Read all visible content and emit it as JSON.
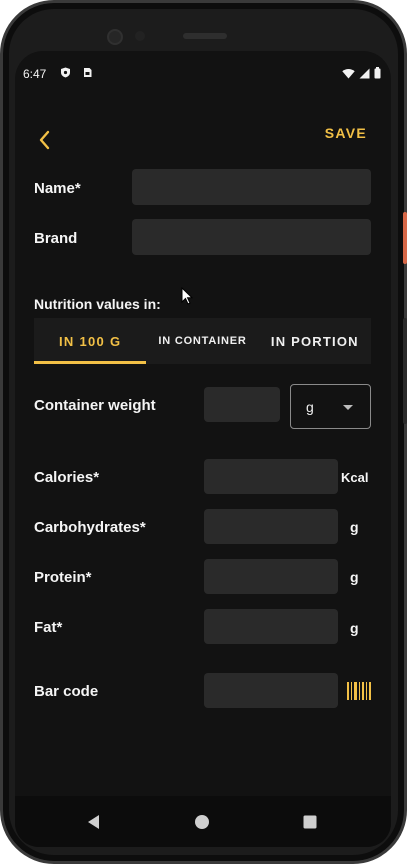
{
  "status_bar": {
    "time": "6:47",
    "left_icons": [
      "shield-icon",
      "sim-icon"
    ],
    "right_icons": [
      "wifi-icon",
      "signal-icon",
      "battery-icon"
    ]
  },
  "app_bar": {
    "back_icon": "chevron-left-icon",
    "save_label": "SAVE"
  },
  "form": {
    "name": {
      "label": "Name*",
      "value": ""
    },
    "brand": {
      "label": "Brand",
      "value": ""
    },
    "nutrition_values_label": "Nutrition values in:",
    "tabs": [
      {
        "label": "IN 100 G",
        "selected": true
      },
      {
        "label": "IN CONTAINER",
        "selected": false
      },
      {
        "label": "IN PORTION",
        "selected": false
      }
    ],
    "container_weight": {
      "label": "Container weight",
      "value": "",
      "unit_selected": "g"
    },
    "calories": {
      "label": "Calories*",
      "value": "",
      "unit": "Kcal"
    },
    "carbohydrates": {
      "label": "Carbohydrates*",
      "value": "",
      "unit": "g"
    },
    "protein": {
      "label": "Protein*",
      "value": "",
      "unit": "g"
    },
    "fat": {
      "label": "Fat*",
      "value": "",
      "unit": "g"
    },
    "bar_code": {
      "label": "Bar code",
      "value": "",
      "icon": "barcode-icon"
    }
  },
  "colors": {
    "accent": "#f2c046",
    "background": "#121212",
    "field": "#2a2a2a",
    "tab_bar": "#1b1b1b"
  },
  "nav_bar": {
    "icons": [
      "back-triangle-icon",
      "home-circle-icon",
      "recents-square-icon"
    ]
  }
}
